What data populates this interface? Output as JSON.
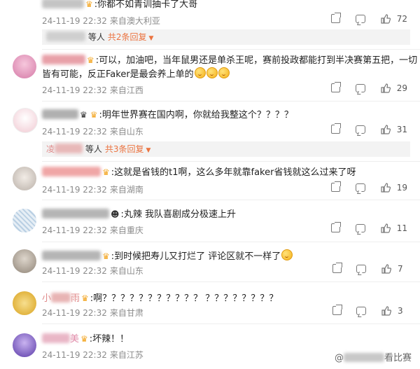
{
  "comments": [
    {
      "text": ":你都不如青训抽卡了大哥",
      "date": "24-11-19 22:32",
      "loc": "来自澳大利亚",
      "likes": "72",
      "name_color": "#b8b8b8",
      "avatar_color": "#cfcfcf"
    },
    {
      "text": ":可以，加油吧，当年鼠男还是单杀王呢，赛前投政都能打到半决赛第五把，一切",
      "text2": "皆有可能，反正Faker是最会养上单的",
      "date": "24-11-19 22:32",
      "loc": "来自江西",
      "likes": "29",
      "name_color": "#e8a0a8",
      "avatar_color": "#e88fb5"
    },
    {
      "text": ":明年世界赛在国内啊，你就给我整这个？？？？",
      "date": "24-11-19 22:32",
      "loc": "来自山东",
      "likes": "31",
      "name_color": "#b0b0b0",
      "avatar_color": "#f3d9df"
    },
    {
      "text": ":这就是省钱的t1啊，这么多年就靠faker省钱就这么过来了呀",
      "date": "24-11-19 22:32",
      "loc": "来自湖南",
      "likes": "19",
      "name_color": "#f0a6a6",
      "avatar_color": "#d8d3cf"
    },
    {
      "text": ":丸辣 我队喜剧成分极速上升",
      "date": "24-11-19 22:32",
      "loc": "来自重庆",
      "likes": "11",
      "name_color": "#b5b5b5",
      "avatar_color": "#c9d9e6"
    },
    {
      "text": ":到时候把寿儿又打烂了 评论区就不一样了",
      "date": "24-11-19 22:32",
      "loc": "来自山东",
      "likes": "7",
      "name_color": "#b5b5b5",
      "avatar_color": "#bdb2a6"
    },
    {
      "text": ":啊？？？？？？？？？？？  ？？？？？？？？",
      "name_prefix": "小",
      "name_suffix": "雨",
      "date": "24-11-19 22:32",
      "loc": "来自甘肃",
      "likes": "3",
      "name_color": "#e8b4b4",
      "avatar_color": "#e8c25a"
    },
    {
      "text": ":坏辣！！",
      "name_suffix": "美",
      "date": "24-11-19 22:32",
      "loc": "来自江苏",
      "likes": "",
      "name_color": "#e9b6c6",
      "avatar_color": "#8866cc"
    }
  ],
  "replies": [
    {
      "who_suffix": "等人",
      "link": "共2条回复"
    },
    {
      "who_prefix": "凌",
      "who_suffix": "等人",
      "link": "共3条回复"
    }
  ],
  "mentions": [
    {
      "who_suffix": "等人"
    }
  ],
  "watermark": {
    "prefix": "@",
    "suffix": "看比赛"
  }
}
